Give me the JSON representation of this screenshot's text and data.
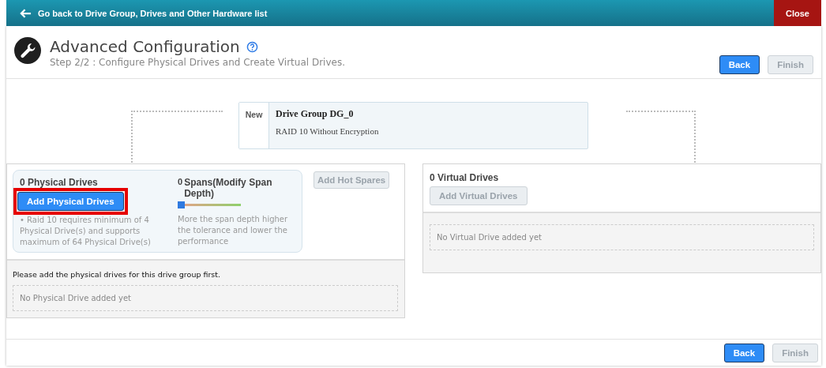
{
  "top_bar": {
    "back_link": "Go back to Drive Group, Drives and Other Hardware list",
    "close_button": "Close"
  },
  "header": {
    "title": "Advanced Configuration",
    "subtitle": "Step 2/2 : Configure Physical Drives and Create Virtual Drives.",
    "buttons": [
      {
        "label": "Back",
        "disabled": false
      },
      {
        "label": "Finish",
        "disabled": true
      }
    ]
  },
  "drive_group": {
    "badge": "New",
    "name": "Drive Group DG_0",
    "description": "RAID 10 Without Encryption"
  },
  "physical": {
    "count_title": "0 Physical Drives",
    "add_button": {
      "label": "Add Physical Drives",
      "disabled": false,
      "highlighted": true
    },
    "note": "• Raid 10 requires minimum of 4 Physical Drive(s) and supports maximum of 64 Physical Drive(s)",
    "spans_count": "0",
    "spans_title": "Spans(Modify Span Depth)",
    "spans_slider": {
      "level": 0
    },
    "spans_hint": "More the span depth higher the tolerance and lower the performance",
    "hot_spares_button": {
      "label": "Add Hot Spares",
      "disabled": true
    },
    "message": "Please add the physical drives for this drive group first.",
    "empty_text": "No Physical Drive added yet"
  },
  "virtual": {
    "count_title": "0 Virtual Drives",
    "add_button": {
      "label": "Add Virtual Drives",
      "disabled": true
    },
    "empty_text": "No Virtual Drive added yet"
  },
  "footer": {
    "buttons": [
      {
        "label": "Back",
        "disabled": false
      },
      {
        "label": "Finish",
        "disabled": true
      }
    ]
  }
}
